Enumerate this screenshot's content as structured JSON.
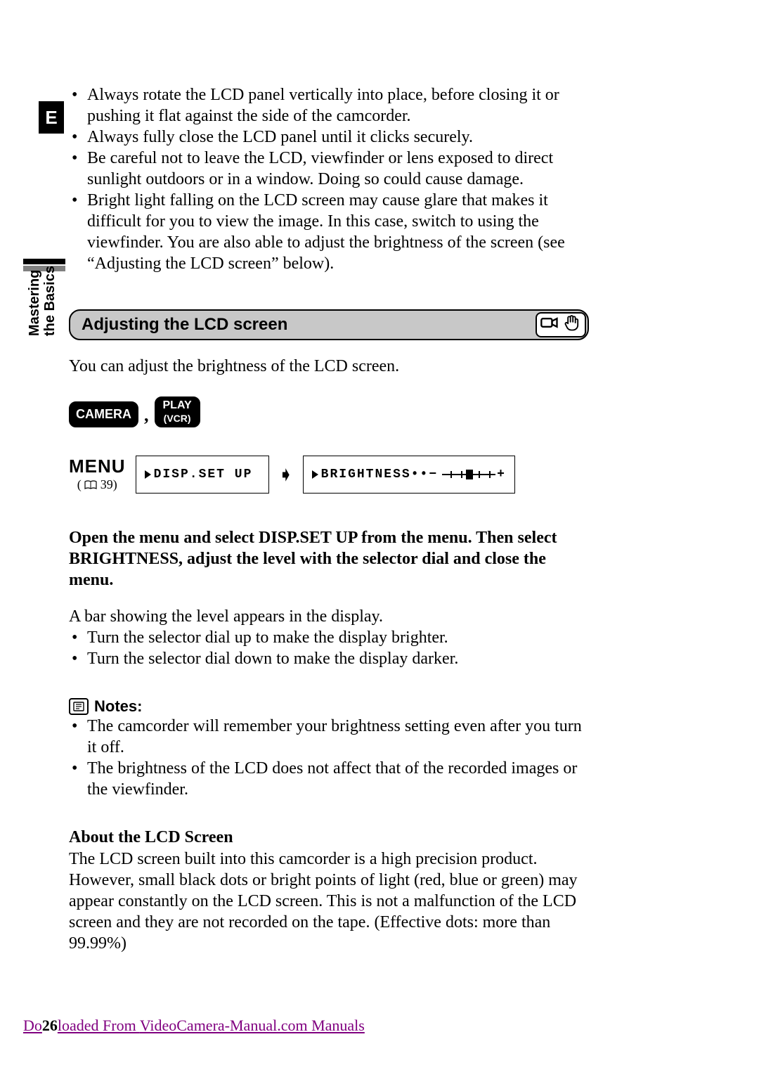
{
  "lang_tab": "E",
  "side_tab": {
    "line1": "Mastering",
    "line2": "the Basics"
  },
  "intro_bullets": [
    "Always rotate the LCD panel vertically into place, before closing it or pushing it flat against the side of the camcorder.",
    "Always fully close the LCD panel until it clicks securely.",
    "Be careful not to leave the LCD, viewfinder or lens exposed to direct sunlight outdoors or in a window. Doing so could cause damage.",
    "Bright light falling on the LCD screen may cause glare that makes it difficult for you to view the image. In this case, switch to using the viewfinder. You are also able to adjust the brightness of the screen (see “Adjusting the LCD screen” below)."
  ],
  "section_title": "Adjusting the LCD screen",
  "section_icon_names": [
    "camcorder-icon",
    "hand-icon"
  ],
  "intro_para": "You can adjust the brightness of the LCD screen.",
  "modes": {
    "camera": "CAMERA",
    "comma": ",",
    "play_line1": "PLAY",
    "play_line2": "(VCR)"
  },
  "menu": {
    "label": "MENU",
    "ref_prefix": "( ",
    "ref_page": "39",
    "ref_suffix": ")"
  },
  "flow": {
    "step1": "DISP.SET UP",
    "arrow": "➧",
    "step2_label": "BRIGHTNESS",
    "step2_dots": "••",
    "step2_minus": "−",
    "step2_plus": "+"
  },
  "instruction": "Open the menu and select DISP.SET UP from the menu. Then select BRIGHTNESS, adjust the level with the selector dial and close the menu.",
  "result_para": "A bar showing the level appears in the display.",
  "result_bullets": [
    "Turn the selector dial up to make the display brighter.",
    "Turn the selector dial down to make the display darker."
  ],
  "notes_heading": "Notes:",
  "notes_bullets": [
    "The camcorder will remember your brightness setting even after you turn it off.",
    "The brightness of the LCD does not affect that of the recorded images or the viewfinder."
  ],
  "about_heading": "About the LCD Screen",
  "about_para": "The LCD screen built into this camcorder is a high precision product. However, small black dots or bright points of light (red, blue or green) may appear constantly on the LCD screen. This is not a malfunction of the LCD screen and they are not recorded on the tape. (Effective dots: more than 99.99%)",
  "footer": {
    "prefix": "Do",
    "page_number": "26",
    "middle": "loaded From ",
    "link": "VideoCamera-Manual.com Manuals"
  }
}
